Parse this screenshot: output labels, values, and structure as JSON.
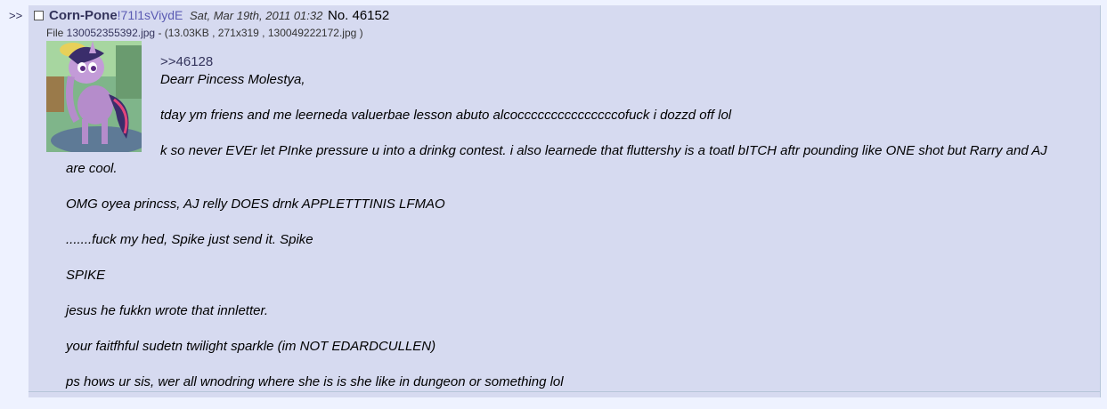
{
  "nav": {
    "arrows": ">>"
  },
  "post": {
    "name": "Corn-Pone",
    "tripcode": "!71l1sViydE",
    "datetime": "Sat, Mar 19th, 2011 01:32",
    "number_label": "No. 46152",
    "file": {
      "prefix": "File ",
      "filename": "130052355392.jpg",
      "details": " - (13.03KB , 271x319 , 130049222172.jpg )"
    },
    "quote_link": ">>46128",
    "lines": {
      "l1": "Dearr Pincess Molestya,",
      "l2": "tday ym friens and me leerneda valuerbae lesson abuto alcocccccccccccccccofuck i dozzd off lol",
      "l3": "k so never EVEr let PInke pressure u into a drinkg contest. i also learnede that fluttershy is a toatl bITCH aftr pounding like ONE shot but Rarry and AJ are cool.",
      "l4": "OMG oyea princss, AJ relly DOES drnk APPLETTTINIS LFMAO",
      "l5": ".......fuck my hed, Spike just send it. Spike",
      "l6": "SPIKE",
      "l7": "jesus he fukkn wrote that innletter.",
      "l8": "your faitfhful sudetn twilight sparkle (im NOT EDARDCULLEN)",
      "l9": "ps hows ur sis, wer all wnodring where she is is she like in dungeon or something lol"
    }
  },
  "colors": {
    "page_bg": "#EEF2FF",
    "reply_bg": "#D6DAF0",
    "link_blue": "#34345C"
  }
}
